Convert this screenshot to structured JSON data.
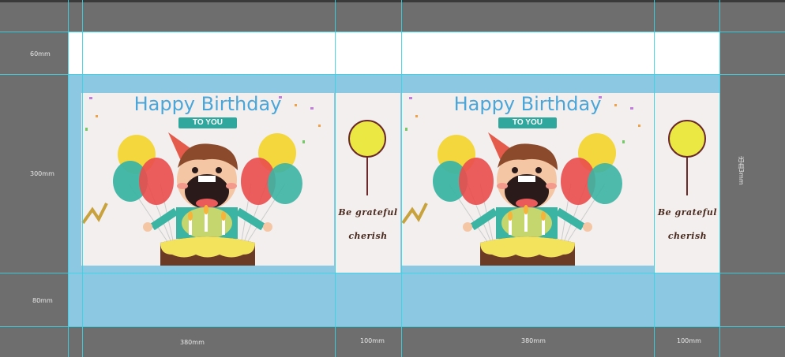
{
  "dimensions": {
    "top_margin": "60mm",
    "height_main": "300mm",
    "bottom_margin": "80mm",
    "width_front_1": "380mm",
    "width_side_1": "100mm",
    "width_front_2": "380mm",
    "width_side_2": "100mm",
    "vertical_note": "出血3mm"
  },
  "panels": [
    {
      "title": "Happy Birthday",
      "ribbon": "TO YOU"
    },
    {
      "title": "Happy Birthday",
      "ribbon": "TO YOU"
    }
  ],
  "side_panels": [
    {
      "line1": "Be grateful",
      "line2": "cherish"
    },
    {
      "line1": "Be grateful",
      "line2": "cherish"
    }
  ],
  "colors": {
    "canvas": "#6e6e6e",
    "packaging_blue": "#8cc8e2",
    "guide": "#37d3e6",
    "title_blue": "#4aa6d8",
    "ribbon_teal": "#2fa79c",
    "lollipop_yellow": "#ece843"
  }
}
